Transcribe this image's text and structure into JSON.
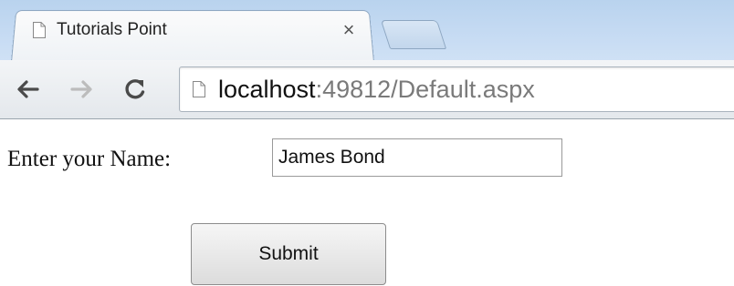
{
  "browser": {
    "tab": {
      "title": "Tutorials Point",
      "close_glyph": "×",
      "icon": "page-icon"
    },
    "toolbar": {
      "back_icon": "back-arrow-icon",
      "forward_icon": "forward-arrow-icon",
      "reload_icon": "reload-icon"
    },
    "address_bar": {
      "icon": "page-icon",
      "host": "localhost",
      "rest": ":49812/Default.aspx"
    }
  },
  "page": {
    "name_label": "Enter your Name:",
    "name_value": "James Bond",
    "submit_label": "Submit"
  },
  "colors": {
    "tab_strip": "#c6dbf3",
    "toolbar": "#e9ecef",
    "url_host": "#111111",
    "url_rest": "#7a7a7a"
  }
}
